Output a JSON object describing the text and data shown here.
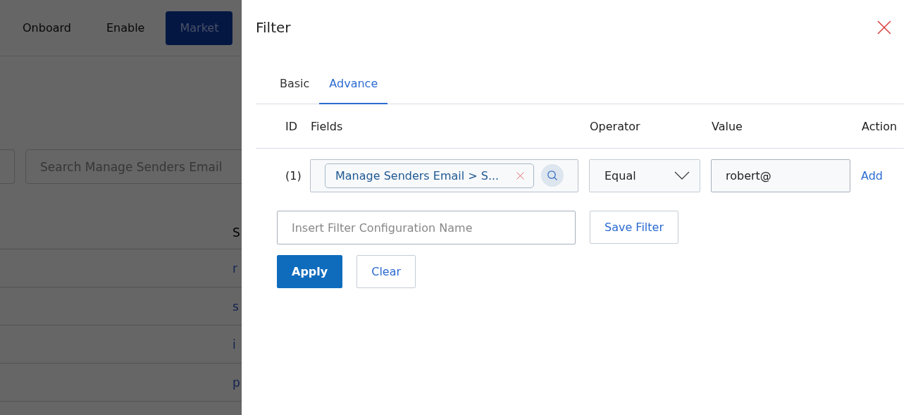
{
  "background": {
    "nav": [
      {
        "label": "Onboard",
        "selected": false
      },
      {
        "label": "Enable",
        "selected": false
      },
      {
        "label": "Market",
        "selected": true
      }
    ],
    "search": {
      "placeholder": "Search Manage Senders Email"
    },
    "table": {
      "column_header": "S",
      "rows": [
        "r",
        "s",
        "i",
        "p"
      ]
    }
  },
  "drawer": {
    "title": "Filter",
    "tabs": [
      {
        "label": "Basic",
        "selected": false
      },
      {
        "label": "Advance",
        "selected": true
      }
    ],
    "columns": [
      "ID",
      "Fields",
      "Operator",
      "Value",
      "Action"
    ],
    "rows": [
      {
        "id": "(1)",
        "field_chip": "Manage Senders Email > S...",
        "operator": "Equal",
        "value": "robert@",
        "action": "Add"
      }
    ],
    "config_name": {
      "placeholder": "Insert Filter Configuration Name"
    },
    "save_button": "Save Filter",
    "apply_button": "Apply",
    "clear_button": "Clear"
  }
}
